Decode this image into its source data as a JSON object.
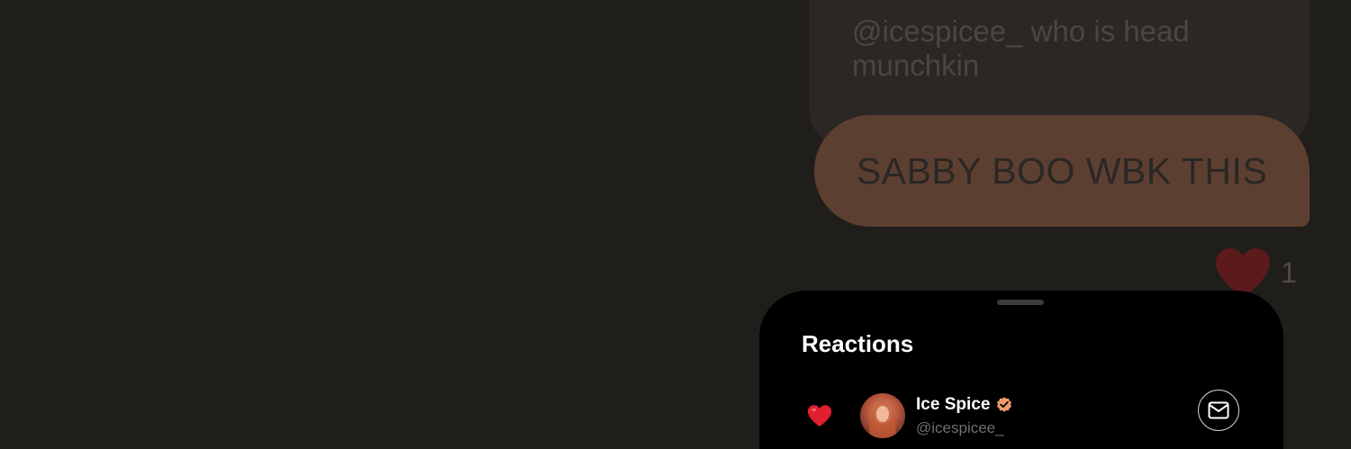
{
  "chat": {
    "received_message": "@icespicee_ who is head munchkin",
    "sent_message": "SABBY BOO WBK THIS",
    "reaction_summary": {
      "emoji_icon": "heart-icon",
      "count": "1"
    }
  },
  "reactions_sheet": {
    "title": "Reactions",
    "items": [
      {
        "reaction_icon": "heart-icon",
        "display_name": "Ice Spice",
        "verified": true,
        "handle": "@icespicee_",
        "action_icon": "envelope-icon"
      }
    ]
  },
  "colors": {
    "background": "#201e1b",
    "sent_bubble": "#5d3f32",
    "received_bubble": "#2a2724",
    "sheet": "#000000",
    "heart": "#e0202e",
    "verified_badge": "#f09a6c"
  }
}
